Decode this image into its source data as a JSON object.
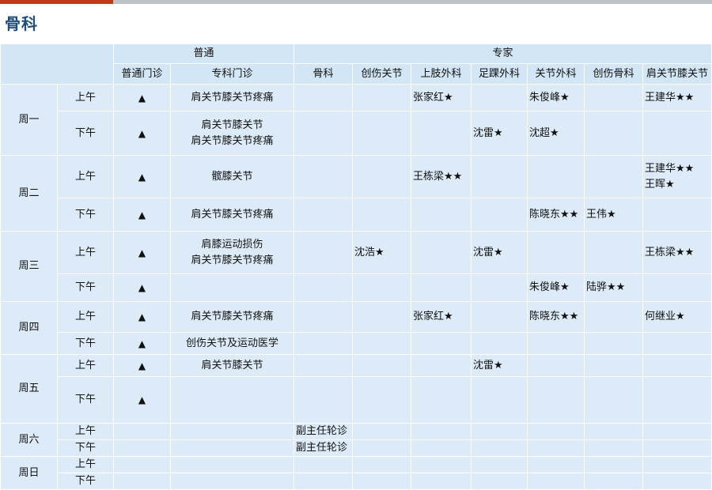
{
  "page": {
    "title": "骨科"
  },
  "header": {
    "groups": [
      "普通",
      "专家"
    ],
    "columns": [
      "普通门诊",
      "专科门诊",
      "骨科",
      "创伤关节",
      "上肢外科",
      "足踝外科",
      "关节外科",
      "创伤骨科",
      "肩关节膝关节"
    ]
  },
  "days": [
    "周一",
    "周二",
    "周三",
    "周四",
    "周五",
    "周六",
    "周日"
  ],
  "periods": [
    "上午",
    "下午"
  ],
  "marks": {
    "triangle": "▲"
  },
  "rows": {
    "mon_am": {
      "special": "肩关节膝关节疼痛",
      "upper": "张家红★",
      "joint": "朱俊峰★",
      "shoulder": "王建华★★"
    },
    "mon_pm": {
      "special_1": "肩关节膝关节",
      "special_2": "肩关节膝关节疼痛",
      "foot": "沈雷★",
      "joint": "沈超★"
    },
    "tue_am": {
      "special": "髋膝关节",
      "upper": "王栋梁★★",
      "shoulder_1": "王建华★★",
      "shoulder_2": "王晖★"
    },
    "tue_pm": {
      "special": "肩关节膝关节疼痛",
      "joint": "陈晓东★★",
      "trauma": "王伟★"
    },
    "wed_am": {
      "special_1": "肩膝运动损伤",
      "special_2": "肩关节膝关节疼痛",
      "trauma_joint": "沈浩★",
      "foot": "沈雷★",
      "shoulder": "王栋梁★★"
    },
    "wed_pm": {
      "joint": "朱俊峰★",
      "trauma": "陆骅★★"
    },
    "thu_am": {
      "special": "肩关节膝关节疼痛",
      "upper": "张家红★",
      "joint": "陈晓东★★",
      "shoulder": "何继业★"
    },
    "thu_pm": {
      "special": "创伤关节及运动医学"
    },
    "fri_am": {
      "special": "肩关节膝关节",
      "foot": "沈雷★"
    },
    "sat_am": {
      "ortho": "副主任轮诊"
    },
    "sat_pm": {
      "ortho": "副主任轮诊"
    }
  }
}
